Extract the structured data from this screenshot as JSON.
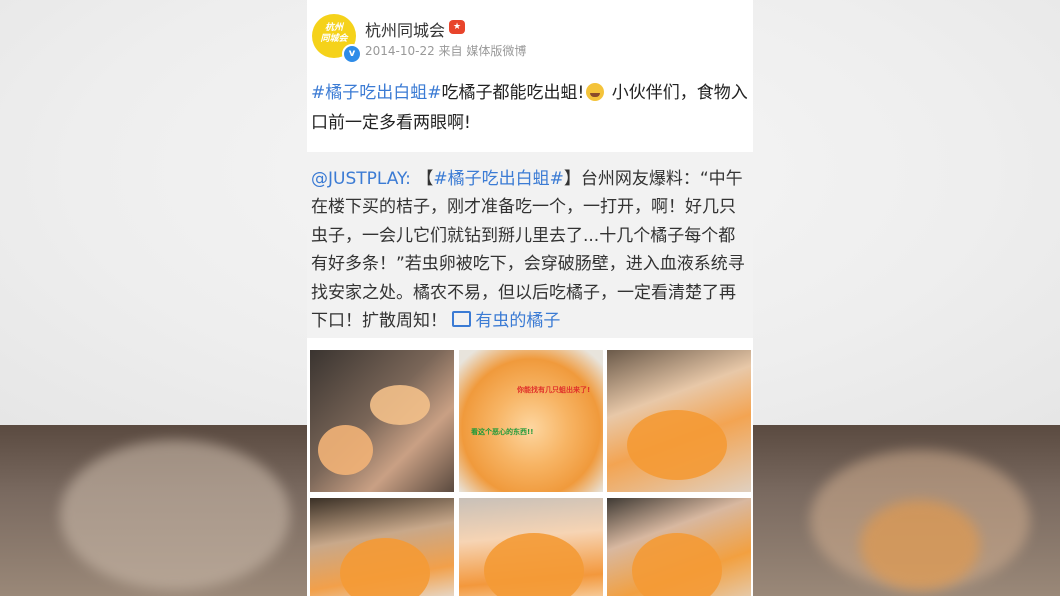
{
  "post": {
    "author": "杭州同城会",
    "avatar_text": "杭州 同城会",
    "verified_icon": "verified-badge-icon",
    "medal_icon": "vip-medal-icon",
    "meta": "2014-10-22 来自 媒体版微博",
    "hashtag": "#橘子吃出白蛆#",
    "text_a": "吃橘子都能吃出蛆!",
    "emoji": "crying-laughing-emoji",
    "text_b": " 小伙伴们，食物入口前一定多看两眼啊!"
  },
  "repost": {
    "mention": "@JUSTPLAY:",
    "open_bracket": " 【",
    "hashtag": "#橘子吃出白蛆#",
    "body": "】台州网友爆料：“中午在楼下买的桔子，刚才准备吃一个，一打开，啊！好几只虫子，一会儿它们就钻到掰儿里去了...十几个橘子每个都有好多条！”若虫卵被吃下，会穿破肠壁，进入血液系统寻找安家之处。橘农不易，但以后吃橘子，一定看清楚了再下口！扩散周知！ ",
    "video_icon": "video-link-icon",
    "video_link": "有虫的橘子"
  },
  "photos": {
    "annotation_red": "你能找有几只蛆出来了!",
    "annotation_green": "看这个恶心的东西!!"
  },
  "colors": {
    "link": "#3b7bd4",
    "quote_bg": "#f2f2f2",
    "verified": "#2f8ce8"
  }
}
